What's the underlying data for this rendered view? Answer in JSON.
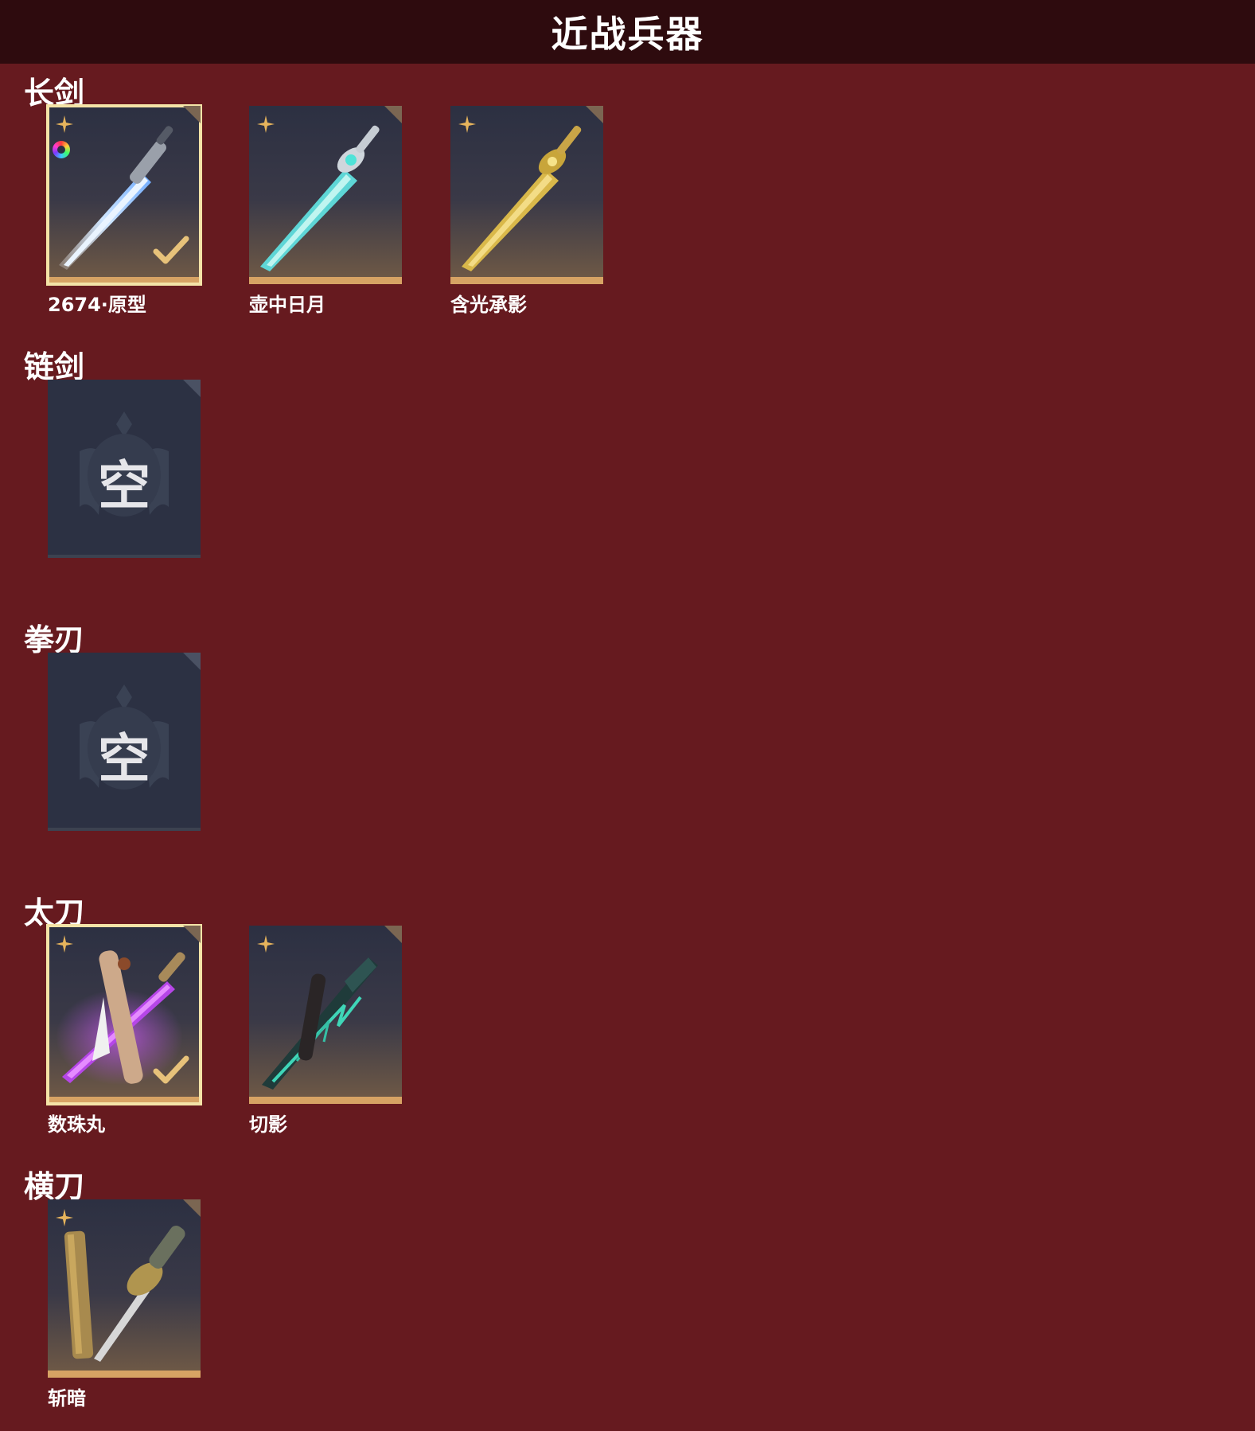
{
  "header": {
    "title": "近战兵器"
  },
  "sections": [
    {
      "title": "长剑",
      "items": [
        {
          "label": "2674·原型",
          "icon": "blue-energy-sword-icon",
          "selected": true
        },
        {
          "label": "壶中日月",
          "icon": "cyan-jade-sword-icon",
          "selected": false
        },
        {
          "label": "含光承影",
          "icon": "golden-sword-icon",
          "selected": false
        }
      ]
    },
    {
      "title": "链剑",
      "items": [
        {
          "empty_text": "空"
        }
      ]
    },
    {
      "title": "拳刃",
      "items": [
        {
          "empty_text": "空"
        }
      ]
    },
    {
      "title": "太刀",
      "items": [
        {
          "label": "数珠丸",
          "icon": "purple-katana-icon",
          "selected": true
        },
        {
          "label": "切影",
          "icon": "teal-dark-katana-icon",
          "selected": false
        }
      ]
    },
    {
      "title": "横刀",
      "items": [
        {
          "label": "斩暗",
          "icon": "golden-sheathed-blade-icon",
          "selected": false
        }
      ]
    }
  ],
  "colors": {
    "background": "#661a1f",
    "header": "#2e0b0e",
    "card_gold_accent": "#d7a364",
    "selected_outline": "#f4e3a7",
    "empty_card": "#2c3143"
  }
}
